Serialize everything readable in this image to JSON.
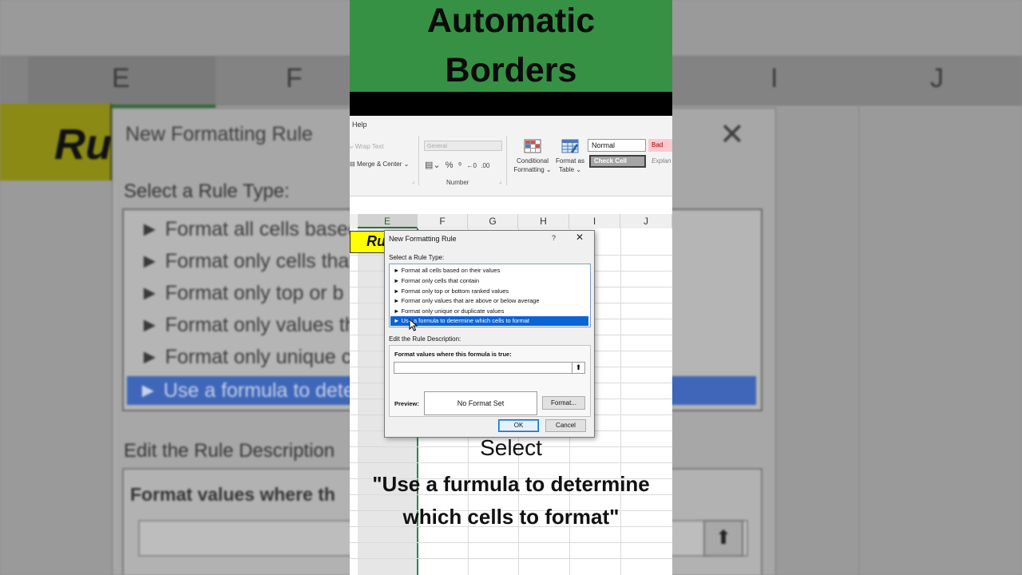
{
  "banner": {
    "line1": "Automatic",
    "line2": "Borders"
  },
  "ribbon": {
    "help_tab": "Help",
    "wrap_text": "Wrap Text",
    "merge_center": "Merge & Center",
    "number_format": "General",
    "number_group": "Number",
    "conditional_formatting": [
      "Conditional",
      "Formatting"
    ],
    "format_as_table": [
      "Format as",
      "Table"
    ],
    "styles": {
      "normal": "Normal",
      "bad": "Bad",
      "check_cell": "Check Cell",
      "explanatory": "Explan"
    }
  },
  "sheet": {
    "columns": [
      "E",
      "F",
      "G",
      "H",
      "I",
      "J"
    ],
    "selected_column": "E",
    "cell_text": "Ru"
  },
  "dialog": {
    "title": "New Formatting Rule",
    "help": "?",
    "close": "✕",
    "select_rule_type_label": "Select a Rule Type:",
    "rule_types": [
      "► Format all cells based on their values",
      "► Format only cells that contain",
      "► Format only top or bottom ranked values",
      "► Format only values that are above or below average",
      "► Format only unique or duplicate values",
      "► Use a formula to determine which cells to format"
    ],
    "selected_rule_index": 5,
    "edit_description_label": "Edit the Rule Description:",
    "formula_label": "Format values where this formula is true:",
    "formula_value": "",
    "collapse_button": "⬆",
    "preview_label": "Preview:",
    "preview_text": "No Format Set",
    "format_button": "Format...",
    "ok_button": "OK",
    "cancel_button": "Cancel"
  },
  "background": {
    "col_e": "E",
    "col_f": "F",
    "col_i": "I",
    "col_j": "J",
    "cell_text": "Ru",
    "dialog_title": "New Formatting Rule",
    "close": "✕",
    "select_rule_type_label": "Select a Rule Type:",
    "items": [
      "► Format all cells based",
      "► Format only cells that",
      "► Format only top or b",
      "► Format only values th",
      "► Format only unique c"
    ],
    "selected_item": "► Use a formula to dete",
    "edit_description_label": "Edit the Rule Description",
    "formula_label": "Format values where th",
    "collapse_button": "⬆"
  },
  "caption": {
    "line1": "Select",
    "line2": "\"Use a furmula to determine which cells to format\""
  },
  "colors": {
    "banner_green": "#369145",
    "selection_blue": "#0a64d6",
    "highlight_yellow": "#ffff00"
  }
}
